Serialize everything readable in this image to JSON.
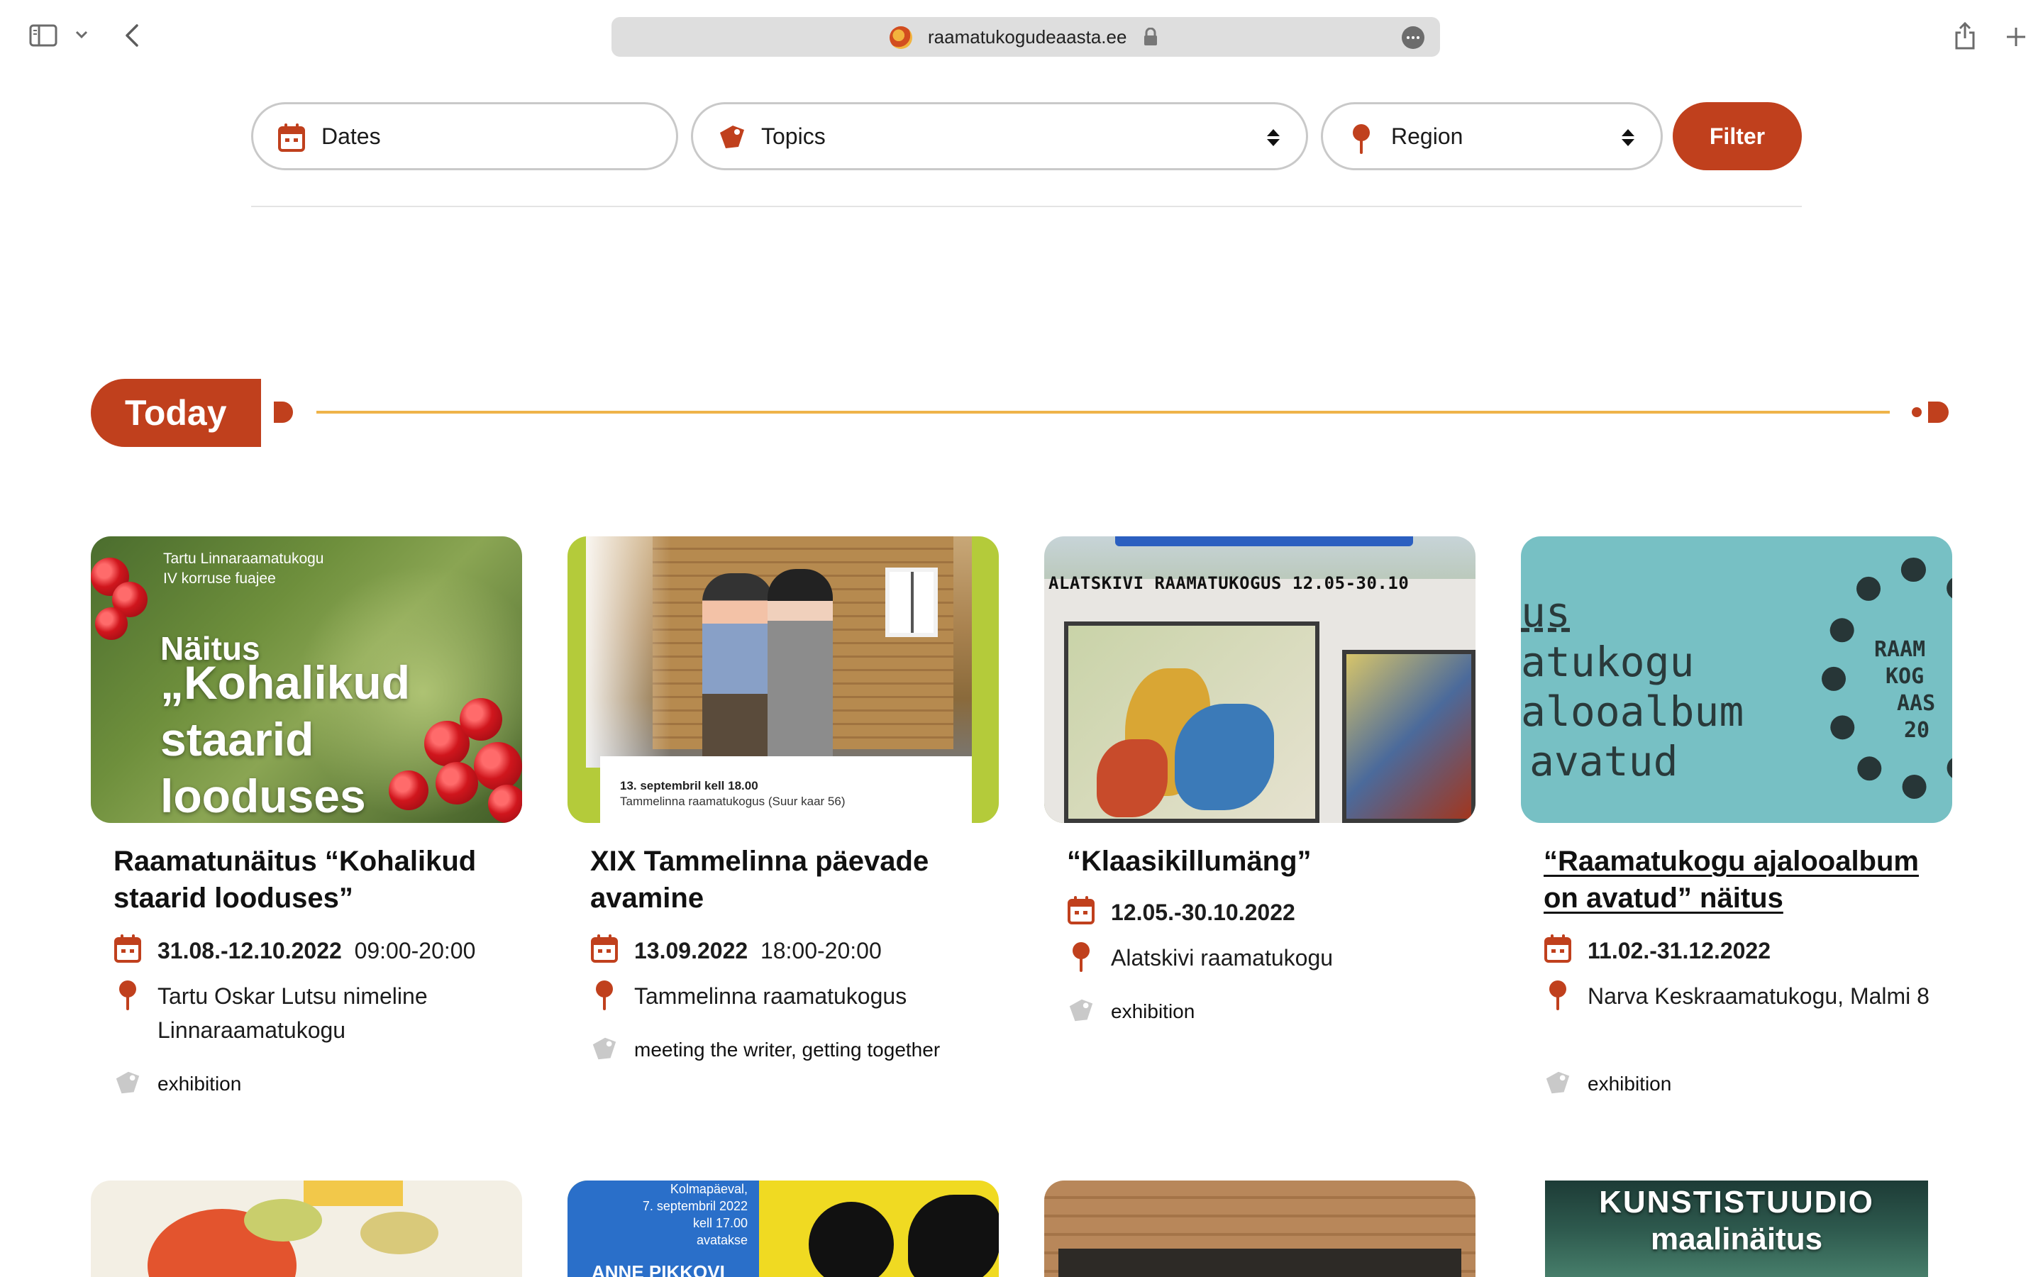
{
  "browser": {
    "url": "raamatukogudeaasta.ee"
  },
  "filters": {
    "dates_label": "Dates",
    "topics_label": "Topics",
    "region_label": "Region",
    "filter_button": "Filter"
  },
  "section": {
    "today_label": "Today"
  },
  "colors": {
    "brand": "#c0401d",
    "accent_line": "#efb44a",
    "tag_icon": "#c9c9c9"
  },
  "cards": [
    {
      "thumb": {
        "caption_1": "Tartu Linnaraamatukogu",
        "caption_2": "IV korruse fuajee",
        "line_1": "Näitus",
        "line_2": "„Kohalikud",
        "line_3": "staarid",
        "line_4": "looduses"
      },
      "title": "Raamatunäitus “Kohalikud staarid looduses”",
      "date": "31.08.-12.10.2022",
      "time": "09:00-20:00",
      "location": "Tartu Oskar Lutsu nimeline Linnaraamatukogu",
      "tags": "exhibition"
    },
    {
      "thumb": {
        "banner_1": "13. septembril kell 18.00",
        "banner_2": "Tammelinna raamatukogus (Suur kaar 56)"
      },
      "title": "XIX Tammelinna päevade avamine",
      "date": "13.09.2022",
      "time": "18:00-20:00",
      "location": "Tammelinna raamatukogus",
      "tags": "meeting the writer, getting together"
    },
    {
      "thumb": {
        "heading": "ALATSKIVI RAAMATUKOGUS 12.05-30.10"
      },
      "title": "“Klaasikillumäng”",
      "date": "12.05.-30.10.2022",
      "time": "",
      "location": "Alatskivi raamatukogu",
      "tags": "exhibition"
    },
    {
      "thumb": {
        "line_1": "us",
        "line_2": "atukogu",
        "line_3": "alooalbum",
        "line_4": "avatud",
        "ring_1": "RAAM",
        "ring_2": "KOG",
        "ring_3": "AAS",
        "ring_4": "20"
      },
      "title": "“Raamatukogu ajalooalbum on avatud” näitus",
      "date": "11.02.-31.12.2022",
      "time": "",
      "location": "Narva Keskraamatukogu, Malmi 8",
      "tags": "exhibition"
    }
  ],
  "bottom_cards": {
    "card2_info_1": "Kolmapäeval,",
    "card2_info_2": "7. septembril 2022",
    "card2_info_3": "kell 17.00",
    "card2_info_4": "avatakse",
    "card2_name": "ANNE PIKKOVI",
    "card4_title_1": "KUNSTISTUUDIO",
    "card4_title_2": "maalinäitus"
  }
}
